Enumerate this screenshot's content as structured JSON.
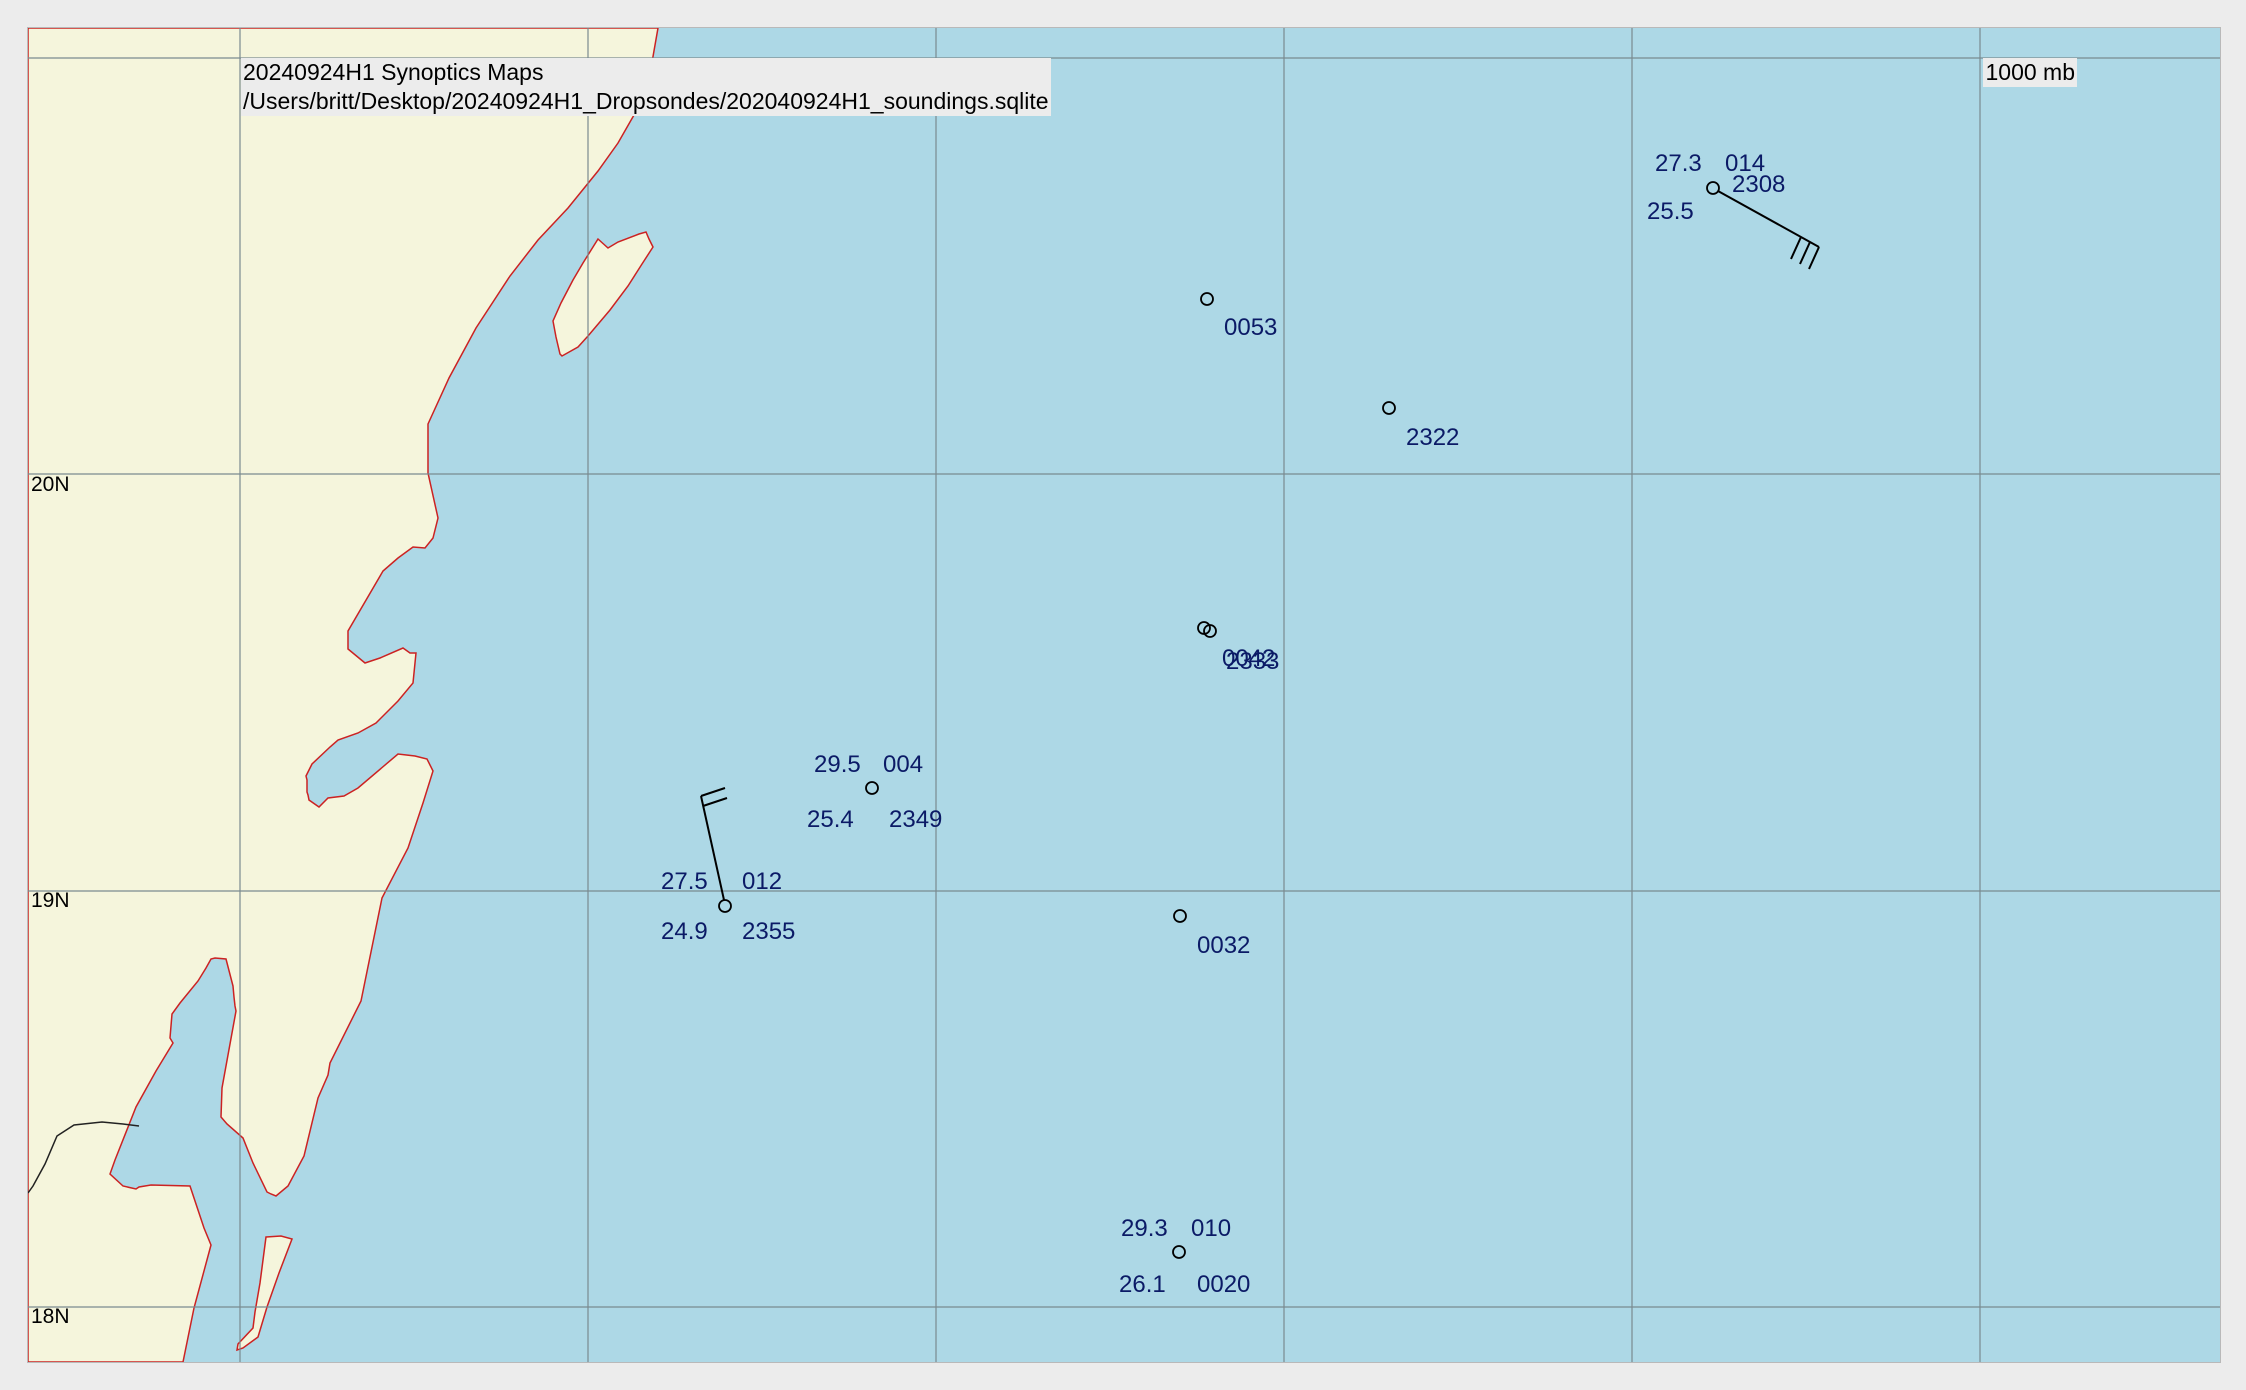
{
  "title": {
    "line1": "20240924H1 Synoptics Maps",
    "line2": "/Users/britt/Desktop/20240924H1_Dropsondes/202040924H1_soundings.sqlite"
  },
  "level_label": "1000 mb",
  "latitude_labels": [
    "20N",
    "19N",
    "18N"
  ],
  "colors": {
    "water": "#add8e6",
    "land": "#f5f5dc",
    "coastline": "#cc2222",
    "grid": "#7a8a90",
    "station_text": "#0b1a66",
    "background": "#ececec"
  },
  "stations": [
    {
      "id": "0053",
      "labels": {
        "time": "0053"
      }
    },
    {
      "id": "2322",
      "labels": {
        "time": "2322"
      }
    },
    {
      "id": "2308",
      "labels": {
        "temp": "27.3",
        "pressure": "014",
        "dewpoint": "25.5",
        "time": "2308"
      },
      "wind_barb": "3 full barbs"
    },
    {
      "id": "0042",
      "labels": {
        "time": "0042"
      }
    },
    {
      "id": "2333",
      "labels": {
        "time": "2333"
      }
    },
    {
      "id": "2349",
      "labels": {
        "temp": "29.5",
        "pressure": "004",
        "dewpoint": "25.4",
        "time": "2349"
      }
    },
    {
      "id": "2355",
      "labels": {
        "temp": "27.5",
        "pressure": "012",
        "dewpoint": "24.9",
        "time": "2355"
      },
      "wind_barb": "2 barbs"
    },
    {
      "id": "0032",
      "labels": {
        "time": "0032"
      }
    },
    {
      "id": "0020",
      "labels": {
        "temp": "29.3",
        "pressure": "010",
        "dewpoint": "26.1",
        "time": "0020"
      }
    }
  ]
}
